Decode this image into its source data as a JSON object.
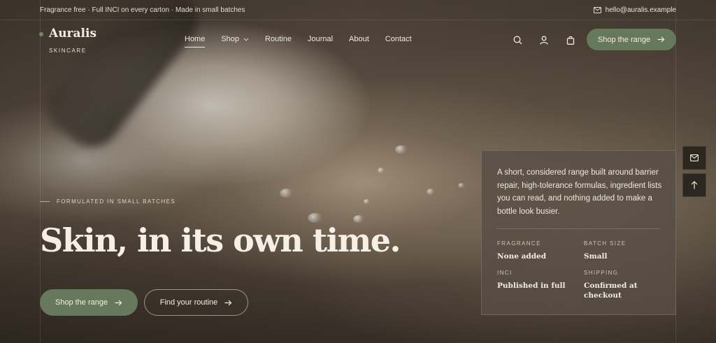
{
  "topbar": {
    "message": "Fragrance free · Full INCI on every carton · Made in small batches",
    "email": "hello@auralis.example"
  },
  "brand": {
    "name": "Auralis",
    "tagline": "SKINCARE"
  },
  "nav": {
    "items": [
      {
        "label": "Home",
        "active": true
      },
      {
        "label": "Shop",
        "has_dropdown": true
      },
      {
        "label": "Routine"
      },
      {
        "label": "Journal"
      },
      {
        "label": "About"
      },
      {
        "label": "Contact"
      }
    ],
    "icons": [
      "search-icon",
      "account-icon",
      "bag-icon"
    ],
    "cta_label": "Shop the range"
  },
  "hero": {
    "eyebrow": "FORMULATED IN SMALL BATCHES",
    "headline": "Skin, in its own time.",
    "primary_cta": "Shop the range",
    "secondary_cta": "Find your routine"
  },
  "info_card": {
    "description": "A short, considered range built around barrier repair, high-tolerance formulas, ingredient lists you can read, and nothing added to make a bottle look busier.",
    "facts": [
      {
        "label": "FRAGRANCE",
        "value": "None added"
      },
      {
        "label": "BATCH SIZE",
        "value": "Small"
      },
      {
        "label": "INCI",
        "value": "Published in full"
      },
      {
        "label": "SHIPPING",
        "value": "Confirmed at checkout"
      }
    ]
  },
  "side_actions": [
    "mail-icon",
    "arrow-up-icon"
  ],
  "colors": {
    "accent_green": "#66795a",
    "text_cream": "#f5efe6",
    "card_bg": "#584e44"
  }
}
